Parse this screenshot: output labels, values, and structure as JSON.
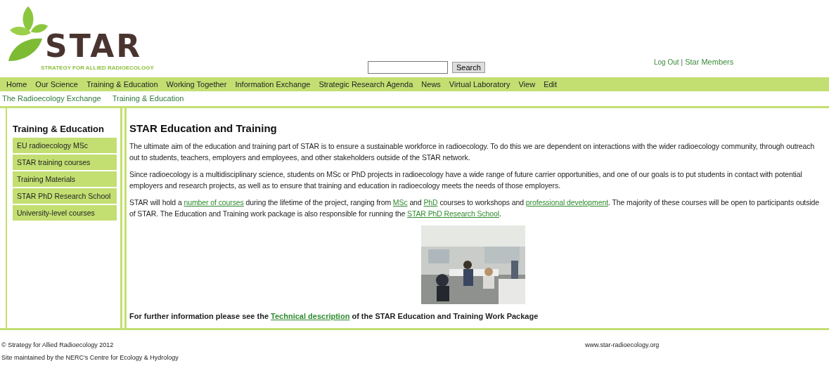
{
  "logo": {
    "name": "STAR",
    "tagline": "STRATEGY FOR ALLIED RADIOECOLOGY"
  },
  "search": {
    "button": "Search"
  },
  "account_links": [
    {
      "label": "Log Out",
      "separator": "|"
    },
    {
      "label": "Star Members"
    }
  ],
  "nav": [
    "Home",
    "Our Science",
    "Training & Education",
    "Working Together",
    "Information Exchange",
    "Strategic Research Agenda",
    "News",
    "Virtual Laboratory",
    "View",
    "Edit"
  ],
  "breadcrumb": [
    "The Radioecology Exchange",
    "Training & Education"
  ],
  "sidebar": {
    "title": "Training & Education",
    "items": [
      "EU radioecology MSc",
      "STAR training courses",
      "Training Materials",
      "STAR PhD Research School",
      "University-level courses"
    ]
  },
  "main": {
    "title": "STAR Education and Training",
    "paragraphs": [
      [
        {
          "kind": "text",
          "text": "The ultimate aim of the education and training part of STAR is to ensure a sustainable workforce in radioecology. To do this we are dependent on interactions with the wider radioecology community, through outreach out to students, teachers, employers and employees, and other stakeholders outside of the STAR network."
        }
      ],
      [
        {
          "kind": "text",
          "text": "Since radioecology is a multidisciplinary science, students on MSc or PhD projects in radioecology have a wide range of future carrier opportunities, and one of our goals is to put students in contact with potential employers and research projects, as well as to ensure that training and education in radioecology meets the needs of those employers."
        }
      ],
      [
        {
          "kind": "text",
          "text": "STAR will hold a "
        },
        {
          "kind": "link",
          "text": "number of courses"
        },
        {
          "kind": "text",
          "text": " during the lifetime of the project, ranging from "
        },
        {
          "kind": "link",
          "text": "MSc"
        },
        {
          "kind": "text",
          "text": " and "
        },
        {
          "kind": "link",
          "text": "PhD"
        },
        {
          "kind": "text",
          "text": " courses to workshops and "
        },
        {
          "kind": "link",
          "text": "professional development"
        },
        {
          "kind": "text",
          "text": ". The majority of these courses will be open to participants outside of STAR. The Education and Training work package is also responsible for running the "
        },
        {
          "kind": "link",
          "text": "STAR PhD Research School"
        },
        {
          "kind": "text",
          "text": "."
        }
      ]
    ],
    "image": {
      "kind": "picture"
    },
    "note": [
      {
        "kind": "text",
        "text": "For further information please see the "
      },
      {
        "kind": "link",
        "text": "Technical description"
      },
      {
        "kind": "text",
        "text": " of the STAR Education and Training Work Package"
      }
    ]
  },
  "footer": {
    "lines": [
      "© Strategy for Allied Radioecology 2012",
      "Site maintained by the NERC's Centre for Ecology & Hydrology"
    ],
    "site": "www.star-radioecology.org"
  }
}
